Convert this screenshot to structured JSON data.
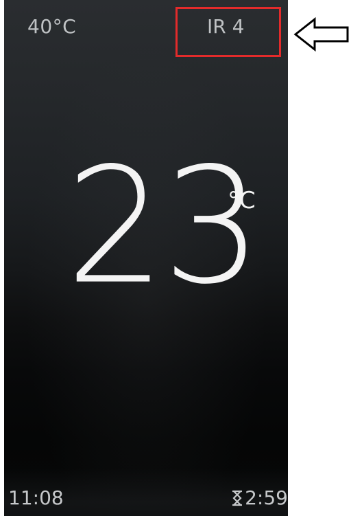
{
  "display": {
    "outside_temp": "40°C",
    "mode": "IR 4",
    "room_temp_value": "23",
    "room_temp_unit": "°C",
    "clock_time": "11:08",
    "timer_remaining": "2:59",
    "timer_icon": "hourglass-icon"
  },
  "annotation": {
    "highlight_color": "#e32b2b",
    "arrow_icon": "left-arrow-icon"
  }
}
